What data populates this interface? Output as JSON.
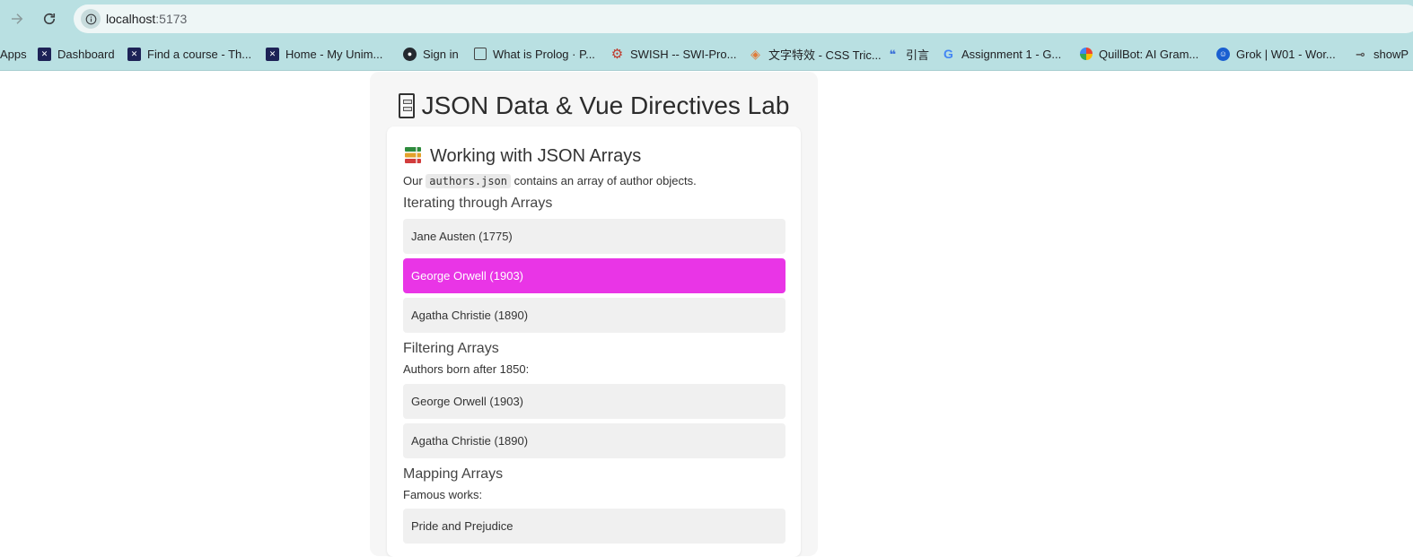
{
  "browser": {
    "url_host": "localhost",
    "url_port": ":5173",
    "bookmarks": [
      {
        "label": "Apps",
        "icon": "apps-icon"
      },
      {
        "label": "Dashboard",
        "icon": "university-logo-icon"
      },
      {
        "label": "Find a course - Th...",
        "icon": "university-logo-icon"
      },
      {
        "label": "Home - My Unim...",
        "icon": "university-logo-icon"
      },
      {
        "label": "Sign in",
        "icon": "github-icon"
      },
      {
        "label": "What is Prolog · P...",
        "icon": "book-icon"
      },
      {
        "label": "SWISH -- SWI-Pro...",
        "icon": "gear-icon"
      },
      {
        "label": "文字特效 - CSS Tric...",
        "icon": "diamond-icon"
      },
      {
        "label": "引言",
        "icon": "quote-icon"
      },
      {
        "label": "Assignment 1 - G...",
        "icon": "google-icon"
      },
      {
        "label": "QuillBot: AI Gram...",
        "icon": "quillbot-icon"
      },
      {
        "label": "Grok | W01 - Wor...",
        "icon": "grok-icon"
      },
      {
        "label": "showP",
        "icon": "key-icon"
      }
    ]
  },
  "page": {
    "title": "JSON Data & Vue Directives Lab",
    "section_title": "Working with JSON Arrays",
    "intro_prefix": "Our",
    "intro_code": "authors.json",
    "intro_suffix": "contains an array of author objects.",
    "iterating": {
      "heading": "Iterating through Arrays",
      "items": [
        "Jane Austen (1775)",
        "George Orwell (1903)",
        "Agatha Christie (1890)"
      ],
      "highlighted_index": 1
    },
    "filtering": {
      "heading": "Filtering Arrays",
      "note": "Authors born after 1850:",
      "items": [
        "George Orwell (1903)",
        "Agatha Christie (1890)"
      ]
    },
    "mapping": {
      "heading": "Mapping Arrays",
      "note": "Famous works:",
      "items": [
        "Pride and Prejudice"
      ]
    }
  },
  "colors": {
    "toolbar_bg": "#b9e0e2",
    "highlight": "#e935e6",
    "item_bg": "#f0f0f0"
  }
}
